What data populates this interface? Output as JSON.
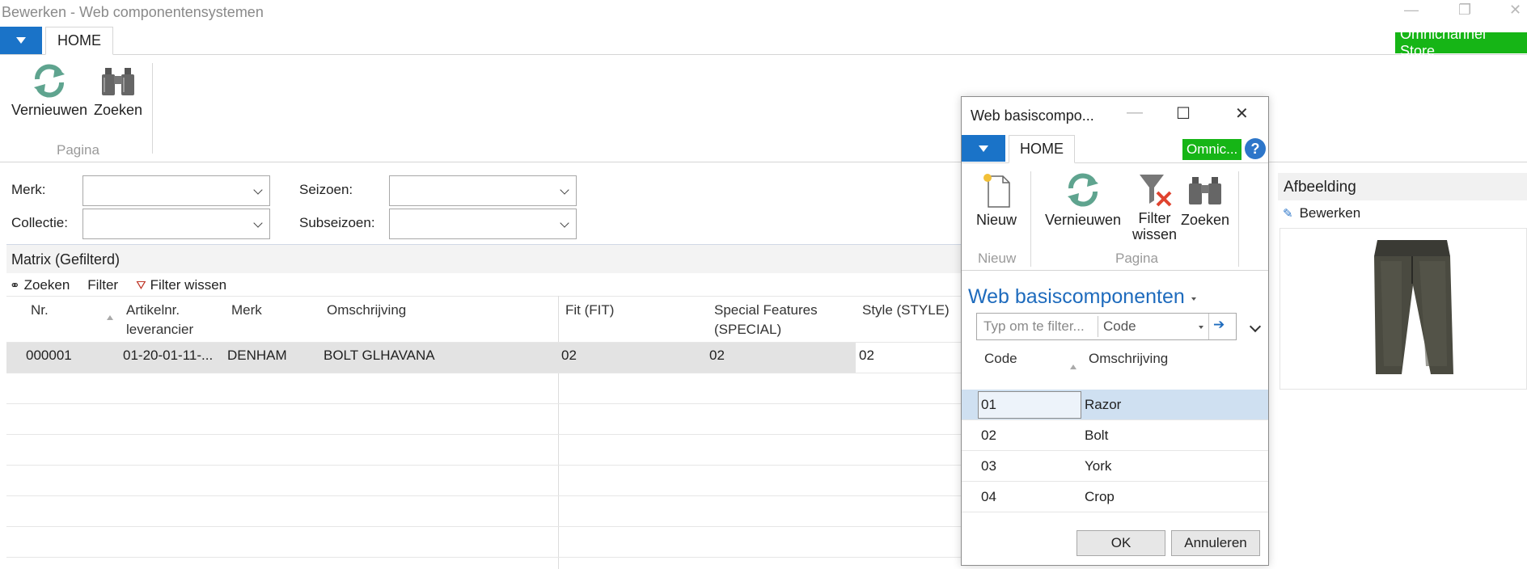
{
  "window": {
    "title": "Bewerken - Web componentensystemen"
  },
  "ribbon": {
    "tab_home": "HOME",
    "store_badge": "Omnichannel Store",
    "refresh_label": "Vernieuwen",
    "find_label": "Zoeken",
    "group_label": "Pagina"
  },
  "filters": {
    "merk_label": "Merk:",
    "merk_value": "",
    "collectie_label": "Collectie:",
    "collectie_value": "",
    "seizoen_label": "Seizoen:",
    "seizoen_value": "",
    "subseizoen_label": "Subseizoen:",
    "subseizoen_value": ""
  },
  "matrix": {
    "title": "Matrix (Gefilterd)",
    "tools": {
      "find": "Zoeken",
      "filter": "Filter",
      "clear_filter": "Filter wissen"
    },
    "columns": {
      "nr": "Nr.",
      "artikelnr_1": "Artikelnr.",
      "artikelnr_2": "leverancier",
      "merk": "Merk",
      "omschrijving": "Omschrijving",
      "fit": "Fit (FIT)",
      "special_1": "Special Features",
      "special_2": "(SPECIAL)",
      "style": "Style (STYLE)"
    },
    "rows": [
      {
        "nr": "000001",
        "artikelnr": "01-20-01-11-...",
        "merk": "DENHAM",
        "omschrijving": "BOLT GLHAVANA",
        "fit": "02",
        "special": "02",
        "style": "02"
      }
    ]
  },
  "image_panel": {
    "title": "Afbeelding",
    "edit_label": "Bewerken"
  },
  "dialog": {
    "title": "Web basiscompo...",
    "tab_home": "HOME",
    "store_badge": "Omnic...",
    "help": "?",
    "new_label": "Nieuw",
    "refresh_label": "Vernieuwen",
    "clear_filter_label_1": "Filter",
    "clear_filter_label_2": "wissen",
    "find_label": "Zoeken",
    "group_new": "Nieuw",
    "group_page": "Pagina",
    "heading": "Web basiscomponenten",
    "search_placeholder": "Typ om te filter...",
    "search_field": "Code",
    "col_code": "Code",
    "col_omschrijving": "Omschrijving",
    "rows": [
      {
        "code": "01",
        "omschrijving": "Razor"
      },
      {
        "code": "02",
        "omschrijving": "Bolt"
      },
      {
        "code": "03",
        "omschrijving": "York"
      },
      {
        "code": "04",
        "omschrijving": "Crop"
      }
    ],
    "ok_label": "OK",
    "cancel_label": "Annuleren"
  }
}
